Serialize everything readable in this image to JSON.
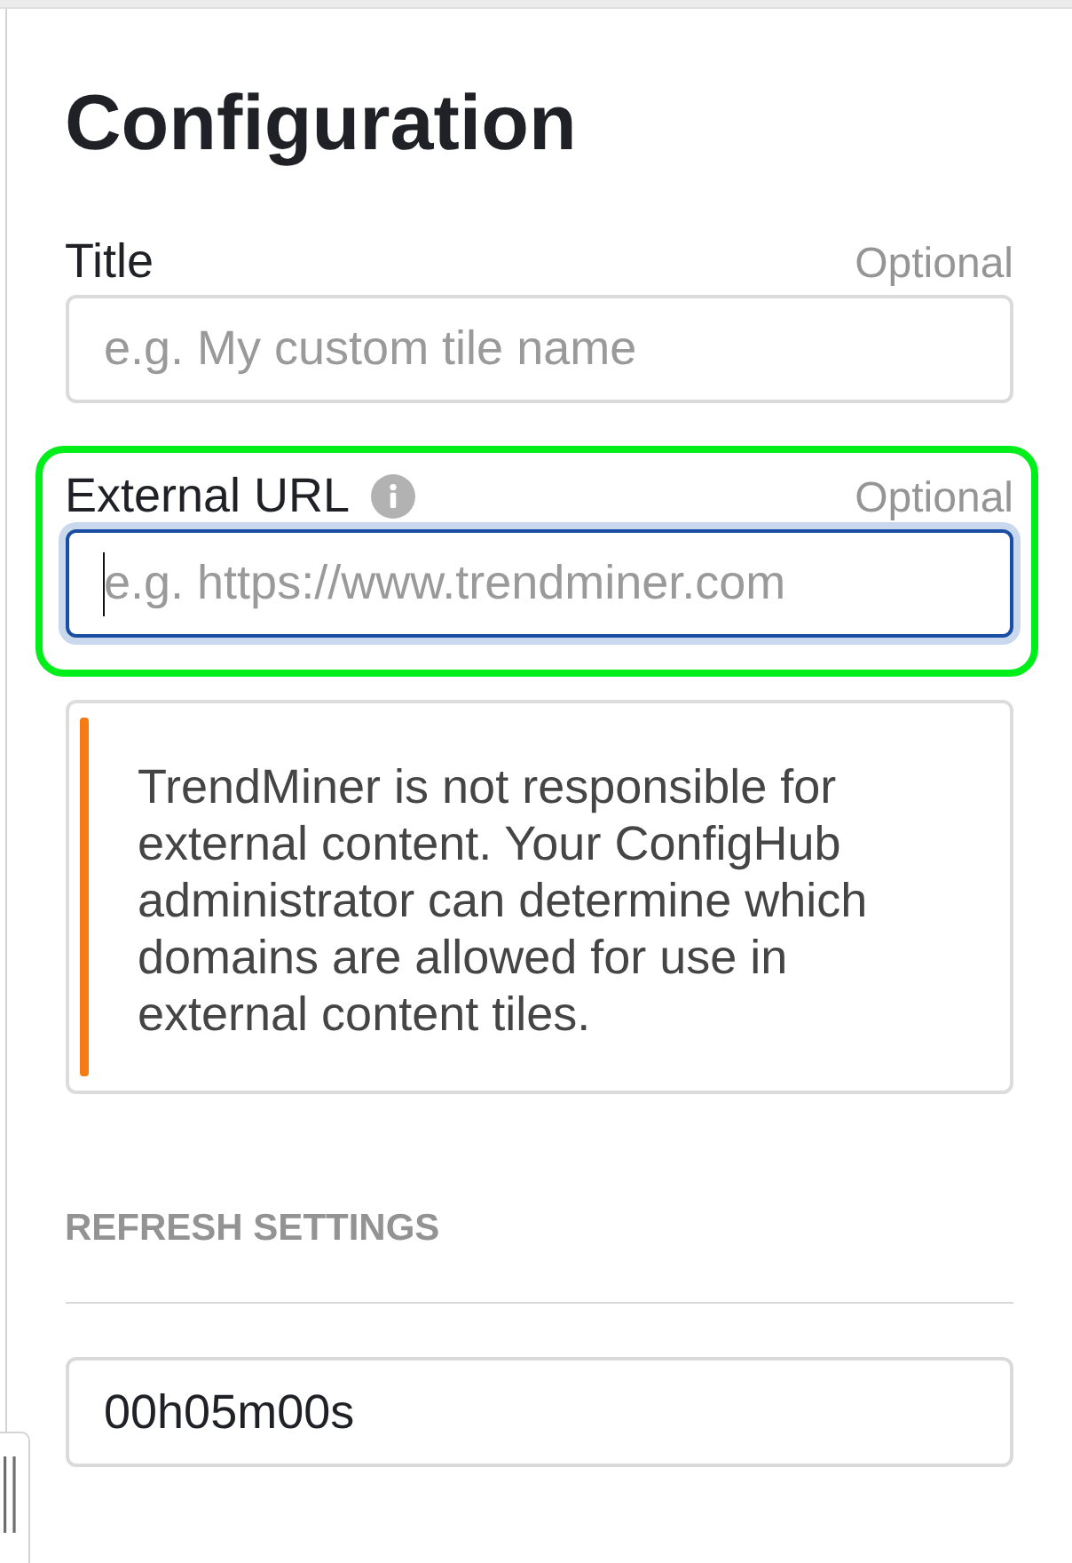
{
  "heading": "Configuration",
  "fields": [
    {
      "label": "Title",
      "info": false,
      "hint": "Optional",
      "placeholder": "e.g. My custom tile name",
      "focused": false,
      "highlighted": false
    },
    {
      "label": "External URL",
      "info": true,
      "hint": "Optional",
      "placeholder": "e.g. https://www.trendminer.com",
      "focused": true,
      "highlighted": true
    }
  ],
  "notice": {
    "text": "TrendMiner is not responsible for external content. Your ConfigHub administrator can determine which domains are allowed for use in external content tiles."
  },
  "refresh_settings": {
    "heading": "REFRESH SETTINGS",
    "value": "00h05m00s"
  }
}
